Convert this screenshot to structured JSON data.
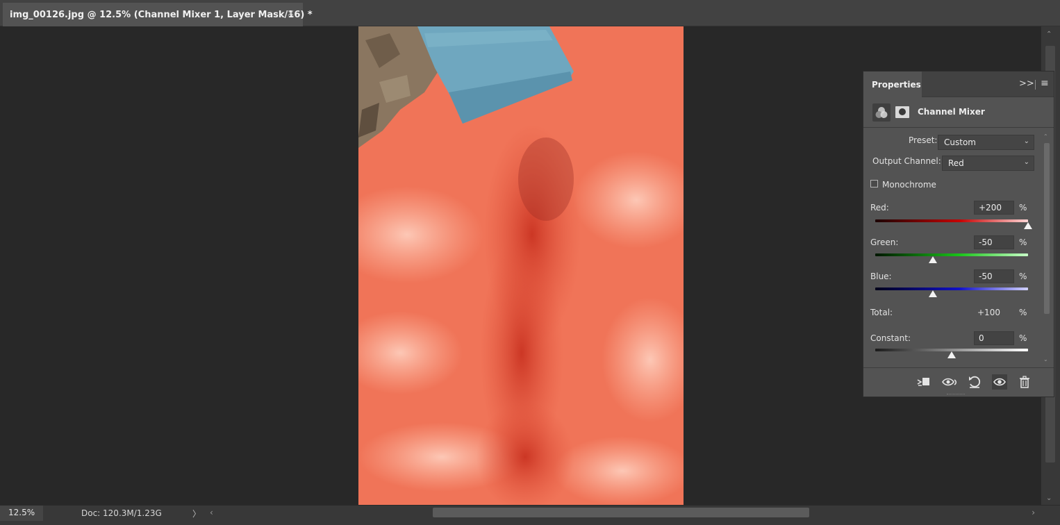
{
  "document": {
    "tab_title": "img_00126.jpg @ 12.5% (Channel Mixer 1, Layer Mask/16) *",
    "close_glyph": "×"
  },
  "status": {
    "zoom": "12.5%",
    "doc_info": "Doc: 120.3M/1.23G"
  },
  "properties": {
    "tab_label": "Properties",
    "title": "Channel Mixer",
    "preset_label": "Preset:",
    "preset_value": "Custom",
    "output_channel_label": "Output Channel:",
    "output_channel_value": "Red",
    "monochrome_label": "Monochrome",
    "monochrome_checked": false,
    "percent": "%",
    "channels": [
      {
        "label": "Red:",
        "value": "+200",
        "level": 200
      },
      {
        "label": "Green:",
        "value": "-50",
        "level": -50
      },
      {
        "label": "Blue:",
        "value": "-50",
        "level": -50
      }
    ],
    "total_label": "Total:",
    "total_value": "+100",
    "constant_label": "Constant:",
    "constant_value": "0",
    "constant_level": 0
  },
  "colors": {
    "photo_base": "#f07458",
    "denim": "#6fa7bf",
    "panel_bg": "#535353"
  }
}
